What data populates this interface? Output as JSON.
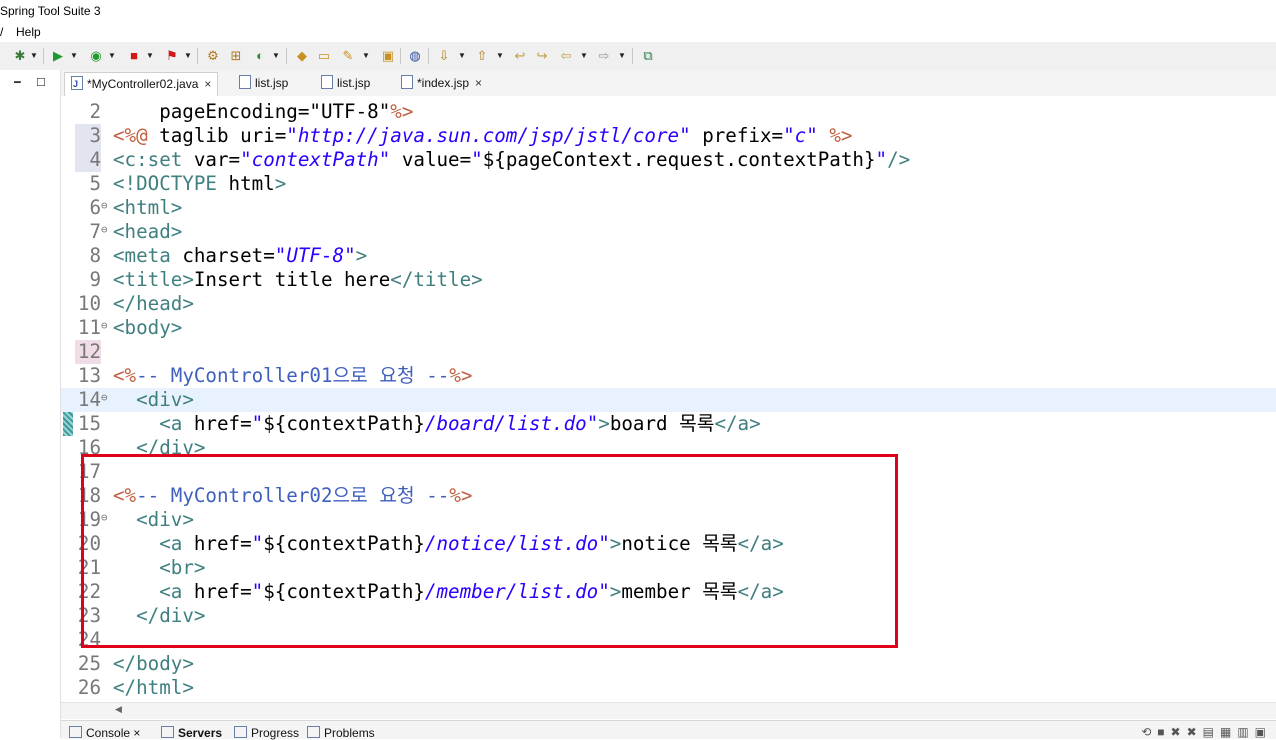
{
  "window": {
    "title": "Spring Tool Suite 3"
  },
  "menu": {
    "left_fragment": "/",
    "help": "Help"
  },
  "editor_tabs": [
    {
      "label": "*MyController02.java",
      "icon": "java-file-icon",
      "close": "×"
    },
    {
      "label": "list.jsp",
      "icon": "jsp-file-icon",
      "close": ""
    },
    {
      "label": "list.jsp",
      "icon": "jsp-file-icon",
      "close": ""
    },
    {
      "label": "*index.jsp",
      "icon": "jsp-file-icon",
      "close": "×"
    }
  ],
  "editor": {
    "current_line": 14,
    "lines": [
      {
        "n": "2",
        "fold": "",
        "text": "    pageEncoding=\"UTF-8\"%>"
      },
      {
        "n": "3",
        "fold": "",
        "text": "<%@ taglib uri=\"http://java.sun.com/jsp/jstl/core\" prefix=\"c\" %>"
      },
      {
        "n": "4",
        "fold": "",
        "text": "<c:set var=\"contextPath\" value=\"${pageContext.request.contextPath}\"/>"
      },
      {
        "n": "5",
        "fold": "",
        "text": "<!DOCTYPE html>"
      },
      {
        "n": "6",
        "fold": "⊖",
        "text": "<html>"
      },
      {
        "n": "7",
        "fold": "⊖",
        "text": "<head>"
      },
      {
        "n": "8",
        "fold": "",
        "text": "<meta charset=\"UTF-8\">"
      },
      {
        "n": "9",
        "fold": "",
        "text": "<title>Insert title here</title>"
      },
      {
        "n": "10",
        "fold": "",
        "text": "</head>"
      },
      {
        "n": "11",
        "fold": "⊖",
        "text": "<body>"
      },
      {
        "n": "12",
        "fold": "",
        "text": ""
      },
      {
        "n": "13",
        "fold": "",
        "text": "<%-- MyController01으로 요청 --%>"
      },
      {
        "n": "14",
        "fold": "⊖",
        "text": "  <div>"
      },
      {
        "n": "15",
        "fold": "",
        "text": "    <a href=\"${contextPath}/board/list.do\">board 목록</a>"
      },
      {
        "n": "16",
        "fold": "",
        "text": "  </div>"
      },
      {
        "n": "17",
        "fold": "",
        "text": ""
      },
      {
        "n": "18",
        "fold": "",
        "text": "<%-- MyController02으로 요청 --%>"
      },
      {
        "n": "19",
        "fold": "⊖",
        "text": "  <div>"
      },
      {
        "n": "20",
        "fold": "",
        "text": "    <a href=\"${contextPath}/notice/list.do\">notice 목록</a>"
      },
      {
        "n": "21",
        "fold": "",
        "text": "    <br>"
      },
      {
        "n": "22",
        "fold": "",
        "text": "    <a href=\"${contextPath}/member/list.do\">member 목록</a>"
      },
      {
        "n": "23",
        "fold": "",
        "text": "  </div>"
      },
      {
        "n": "24",
        "fold": "",
        "text": ""
      },
      {
        "n": "25",
        "fold": "",
        "text": "</body>"
      },
      {
        "n": "26",
        "fold": "",
        "text": "</html>"
      }
    ]
  },
  "bottom_tabs": [
    {
      "label": "Console",
      "close": "×"
    },
    {
      "label": "Servers",
      "close": ""
    },
    {
      "label": "Progress",
      "close": ""
    },
    {
      "label": "Problems",
      "close": ""
    }
  ],
  "colors": {
    "highlight_border": "#e0001a",
    "tag": "#3f7f7f",
    "attribute": "#7f007f",
    "string": "#2a00ff",
    "jsp_delimiter": "#bf5f3f",
    "comment": "#3f5fbf",
    "current_line_bg": "#e8f2fe"
  }
}
